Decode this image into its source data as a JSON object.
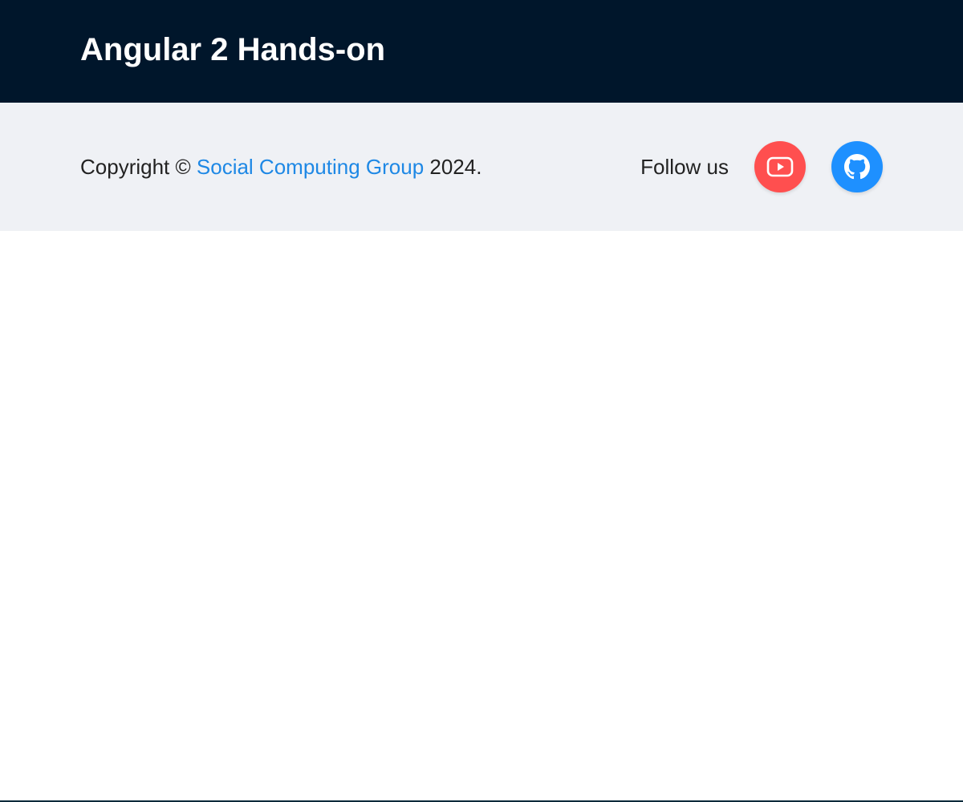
{
  "header": {
    "title": "Angular 2 Hands-on"
  },
  "footer": {
    "copyright_prefix": "Copyright ©",
    "org_link_text": "Social Computing Group",
    "copyright_suffix": "2024.",
    "follow_label": "Follow us",
    "social": [
      {
        "name": "youtube",
        "icon": "youtube-icon",
        "color": "#ff4f4f"
      },
      {
        "name": "github",
        "icon": "github-icon",
        "color": "#1e90ff"
      }
    ]
  },
  "colors": {
    "header_bg": "#00162b",
    "footer_bg": "#eff1f5",
    "link": "#1e88e5"
  }
}
